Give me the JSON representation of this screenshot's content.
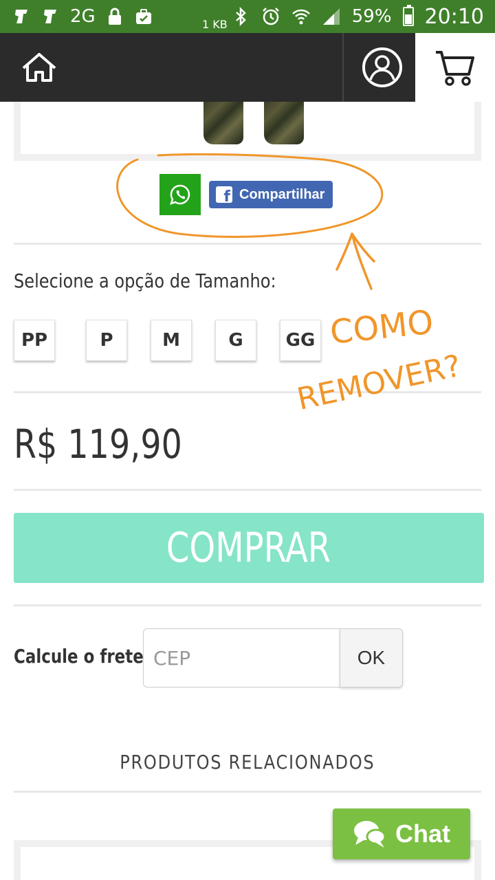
{
  "status_bar": {
    "network": "2G",
    "data_rate": "1 KB",
    "battery_percent": "59%",
    "battery_level": 0.59,
    "time": "20:10",
    "icons": [
      "app-notification-icon",
      "app-notification-icon",
      "lock-icon",
      "briefcase-icon",
      "bluetooth-icon",
      "alarm-icon",
      "wifi-icon",
      "signal-icon",
      "battery-icon"
    ],
    "color": "#3f7f2a"
  },
  "header": {
    "icons": [
      "home-icon",
      "user-account-icon",
      "cart-icon"
    ],
    "color": "#2b2b2b"
  },
  "share": {
    "whatsapp_icon": "whatsapp-icon",
    "facebook_label": "Compartilhar",
    "whatsapp_color": "#23a319",
    "facebook_color": "#4267b2"
  },
  "sizes": {
    "label": "Selecione a opção de Tamanho:",
    "options": [
      "PP",
      "P",
      "M",
      "G",
      "GG"
    ]
  },
  "price": "R$ 119,90",
  "buy_button": {
    "label": "COMPRAR",
    "color": "#86e4c8"
  },
  "shipping": {
    "label": "Calcule o frete",
    "placeholder": "CEP",
    "value": "",
    "button": "OK"
  },
  "related": {
    "title": "PRODUTOS RELACIONADOS"
  },
  "chat": {
    "label": "Chat",
    "color": "#7cc043"
  },
  "annotation": {
    "line1": "COMO",
    "line2": "REMOVER?",
    "color": "#f0962a"
  }
}
